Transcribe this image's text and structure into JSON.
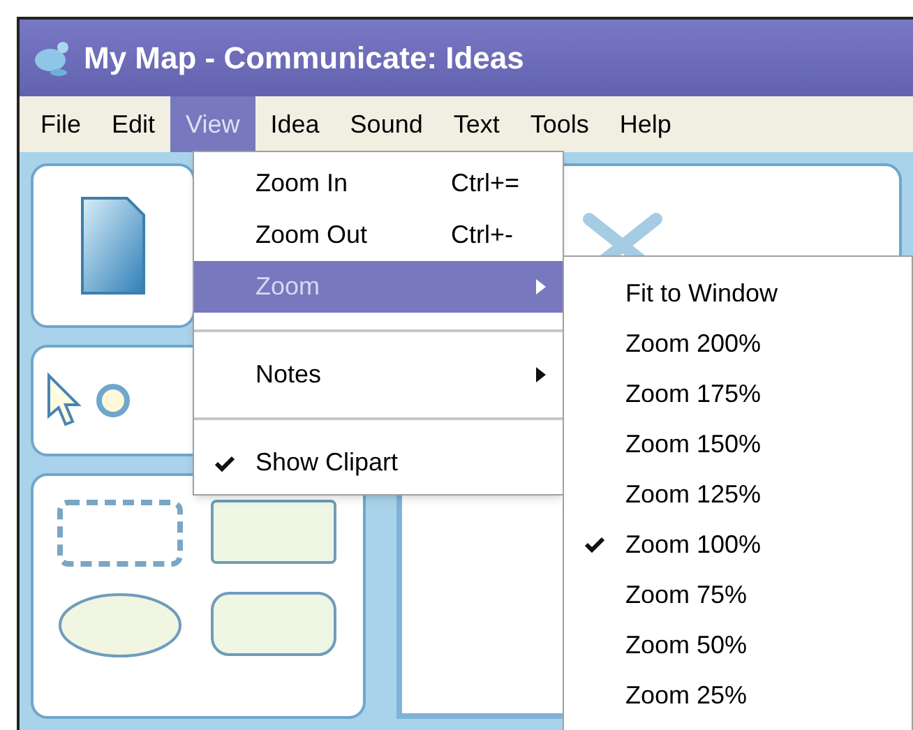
{
  "window": {
    "title": "My Map - Communicate: Ideas"
  },
  "menu_bar": [
    {
      "label": "File",
      "selected": false
    },
    {
      "label": "Edit",
      "selected": false
    },
    {
      "label": "View",
      "selected": true
    },
    {
      "label": "Idea",
      "selected": false
    },
    {
      "label": "Sound",
      "selected": false
    },
    {
      "label": "Text",
      "selected": false
    },
    {
      "label": "Tools",
      "selected": false
    },
    {
      "label": "Help",
      "selected": false
    }
  ],
  "view_menu": {
    "items": [
      {
        "kind": "item",
        "label": "Zoom In",
        "shortcut": "Ctrl+=",
        "selected": false,
        "checked": false
      },
      {
        "kind": "item",
        "label": "Zoom Out",
        "shortcut": "Ctrl+-",
        "selected": false,
        "checked": false
      },
      {
        "kind": "submenu",
        "label": "Zoom",
        "selected": true,
        "checked": false
      },
      {
        "kind": "separator"
      },
      {
        "kind": "submenu",
        "label": "Notes",
        "selected": false,
        "checked": false
      },
      {
        "kind": "separator"
      },
      {
        "kind": "item",
        "label": "Show Clipart",
        "selected": false,
        "checked": true
      }
    ]
  },
  "zoom_submenu": {
    "items": [
      {
        "label": "Fit to Window",
        "checked": false
      },
      {
        "label": "Zoom 200%",
        "checked": false
      },
      {
        "label": "Zoom 175%",
        "checked": false
      },
      {
        "label": "Zoom 150%",
        "checked": false
      },
      {
        "label": "Zoom 125%",
        "checked": false
      },
      {
        "label": "Zoom 100%",
        "checked": true
      },
      {
        "label": "Zoom 75%",
        "checked": false
      },
      {
        "label": "Zoom 50%",
        "checked": false
      },
      {
        "label": "Zoom 25%",
        "checked": false
      }
    ]
  }
}
